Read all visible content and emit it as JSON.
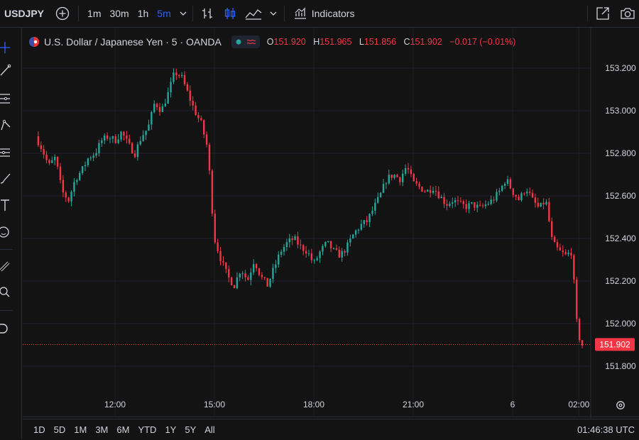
{
  "toolbar": {
    "symbol": "USDJPY",
    "intervals": [
      "1m",
      "30m",
      "1h",
      "5m"
    ],
    "active_interval": "5m",
    "indicators_label": "Indicators"
  },
  "legend": {
    "title": "U.S. Dollar / Japanese Yen · 5 · OANDA",
    "open_label": "O",
    "open": "151.920",
    "high_label": "H",
    "high": "151.965",
    "low_label": "L",
    "low": "151.856",
    "close_label": "C",
    "close": "151.902",
    "change": "−0.017 (−0.01%)"
  },
  "bottom": {
    "ranges": [
      "1D",
      "5D",
      "1M",
      "3M",
      "6M",
      "YTD",
      "1Y",
      "5Y",
      "All"
    ],
    "clock": "01:46:38 UTC"
  },
  "colors": {
    "up": "#26a69a",
    "down": "#f23645",
    "background": "#131313",
    "grid": "#1f222b"
  },
  "chart_data": {
    "type": "candlestick",
    "symbol": "USDJPY",
    "interval": "5",
    "y_ticks": [
      "153.200",
      "153.000",
      "152.800",
      "152.600",
      "152.400",
      "152.200",
      "152.000",
      "151.800"
    ],
    "ylim": [
      151.7,
      153.3
    ],
    "x_ticks": [
      {
        "label": "12:00",
        "t": 12.0
      },
      {
        "label": "15:00",
        "t": 15.0
      },
      {
        "label": "18:00",
        "t": 18.0
      },
      {
        "label": "21:00",
        "t": 21.0
      },
      {
        "label": "6",
        "t": 24.0
      },
      {
        "label": "02:00",
        "t": 26.0
      }
    ],
    "last_price": "151.902",
    "close_path": [
      [
        9.6,
        152.88
      ],
      [
        9.8,
        152.82
      ],
      [
        10.0,
        152.74
      ],
      [
        10.2,
        152.78
      ],
      [
        10.4,
        152.62
      ],
      [
        10.6,
        152.58
      ],
      [
        10.8,
        152.68
      ],
      [
        11.0,
        152.72
      ],
      [
        11.2,
        152.78
      ],
      [
        11.4,
        152.8
      ],
      [
        11.6,
        152.86
      ],
      [
        11.8,
        152.88
      ],
      [
        12.0,
        152.86
      ],
      [
        12.2,
        152.9
      ],
      [
        12.4,
        152.84
      ],
      [
        12.6,
        152.8
      ],
      [
        12.8,
        152.88
      ],
      [
        13.0,
        152.92
      ],
      [
        13.2,
        153.04
      ],
      [
        13.4,
        153.0
      ],
      [
        13.6,
        153.08
      ],
      [
        13.8,
        153.18
      ],
      [
        14.0,
        153.16
      ],
      [
        14.2,
        153.08
      ],
      [
        14.4,
        153.0
      ],
      [
        14.6,
        152.94
      ],
      [
        14.8,
        152.82
      ],
      [
        14.9,
        152.6
      ],
      [
        15.0,
        152.4
      ],
      [
        15.2,
        152.3
      ],
      [
        15.4,
        152.22
      ],
      [
        15.6,
        152.18
      ],
      [
        15.8,
        152.26
      ],
      [
        16.0,
        152.2
      ],
      [
        16.2,
        152.3
      ],
      [
        16.4,
        152.22
      ],
      [
        16.6,
        152.18
      ],
      [
        16.8,
        152.26
      ],
      [
        17.0,
        152.34
      ],
      [
        17.2,
        152.38
      ],
      [
        17.4,
        152.4
      ],
      [
        17.6,
        152.36
      ],
      [
        17.8,
        152.34
      ],
      [
        18.0,
        152.28
      ],
      [
        18.2,
        152.34
      ],
      [
        18.4,
        152.38
      ],
      [
        18.6,
        152.34
      ],
      [
        18.8,
        152.32
      ],
      [
        19.0,
        152.36
      ],
      [
        19.2,
        152.42
      ],
      [
        19.4,
        152.46
      ],
      [
        19.6,
        152.48
      ],
      [
        19.8,
        152.54
      ],
      [
        20.0,
        152.6
      ],
      [
        20.2,
        152.68
      ],
      [
        20.4,
        152.7
      ],
      [
        20.6,
        152.68
      ],
      [
        20.8,
        152.74
      ],
      [
        21.0,
        152.66
      ],
      [
        21.2,
        152.64
      ],
      [
        21.4,
        152.62
      ],
      [
        21.6,
        152.64
      ],
      [
        21.8,
        152.6
      ],
      [
        22.0,
        152.56
      ],
      [
        22.2,
        152.58
      ],
      [
        22.4,
        152.56
      ],
      [
        22.6,
        152.55
      ],
      [
        22.8,
        152.56
      ],
      [
        23.0,
        152.54
      ],
      [
        23.2,
        152.56
      ],
      [
        23.4,
        152.58
      ],
      [
        23.6,
        152.62
      ],
      [
        23.8,
        152.68
      ],
      [
        24.0,
        152.62
      ],
      [
        24.2,
        152.58
      ],
      [
        24.4,
        152.64
      ],
      [
        24.6,
        152.58
      ],
      [
        24.8,
        152.54
      ],
      [
        25.0,
        152.58
      ],
      [
        25.2,
        152.38
      ],
      [
        25.4,
        152.34
      ],
      [
        25.6,
        152.32
      ],
      [
        25.8,
        152.34
      ],
      [
        25.9,
        152.04
      ],
      [
        26.0,
        151.94
      ],
      [
        26.1,
        151.9
      ]
    ]
  }
}
